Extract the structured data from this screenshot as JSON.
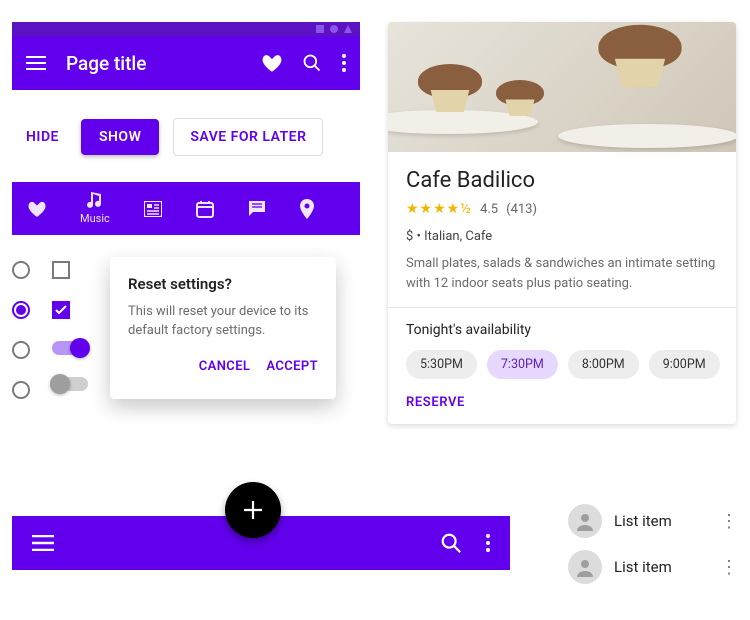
{
  "appbar": {
    "title": "Page title"
  },
  "buttons": {
    "hide": "HIDE",
    "show": "SHOW",
    "save_later": "SAVE FOR LATER"
  },
  "tabs": {
    "music": "Music"
  },
  "dialog": {
    "title": "Reset settings?",
    "body": "This will reset your device to its default factory settings.",
    "cancel": "CANCEL",
    "accept": "ACCEPT"
  },
  "card": {
    "title": "Cafe Badilico",
    "rating_value": "4.5",
    "rating_count": "(413)",
    "meta": "$ • Italian, Cafe",
    "desc": "Small plates, salads & sandwiches an intimate setting with 12 indoor seats plus patio seating.",
    "availability_header": "Tonight's availability",
    "chips": [
      "5:30PM",
      "7:30PM",
      "8:00PM",
      "9:00PM"
    ],
    "chip_selected_index": 1,
    "reserve": "RESERVE"
  },
  "list": {
    "items": [
      "List item",
      "List item"
    ]
  }
}
